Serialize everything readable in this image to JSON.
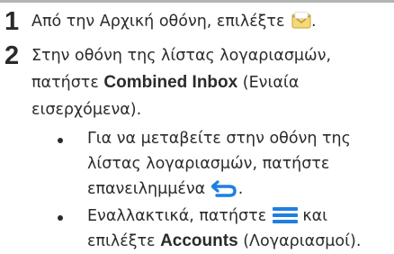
{
  "steps": [
    {
      "number": "1",
      "text_before": "Από την Αρχική οθόνη, επιλέξτε",
      "icon": "email-app-icon",
      "text_after": "."
    },
    {
      "number": "2",
      "line1": "Στην οθόνη της λίστας λογαριασμών,",
      "line2_prefix": "πατήστε",
      "line2_bold": "Combined Inbox",
      "line2_suffix": "(Ενιαία",
      "line3": "εισερχόμενα).",
      "bullets": [
        {
          "line1": "Για να μεταβείτε στην οθόνη της",
          "line2": "λίστας λογαριασμών, πατήστε",
          "line3_prefix": "επανειλημμένα",
          "line3_icon": "back-arrow-icon",
          "line3_suffix": "."
        },
        {
          "line1_prefix": "Εναλλακτικά, πατήστε",
          "line1_icon": "menu-icon",
          "line1_suffix": "και",
          "line2_prefix": "επιλέξτε",
          "line2_bold": "Accounts",
          "line2_suffix": "(Λογαριασμοί)."
        }
      ]
    }
  ],
  "colors": {
    "text": "#2b2b2b",
    "accent_blue": "#1f7fe0",
    "icon_yellow": "#e8c24a"
  }
}
